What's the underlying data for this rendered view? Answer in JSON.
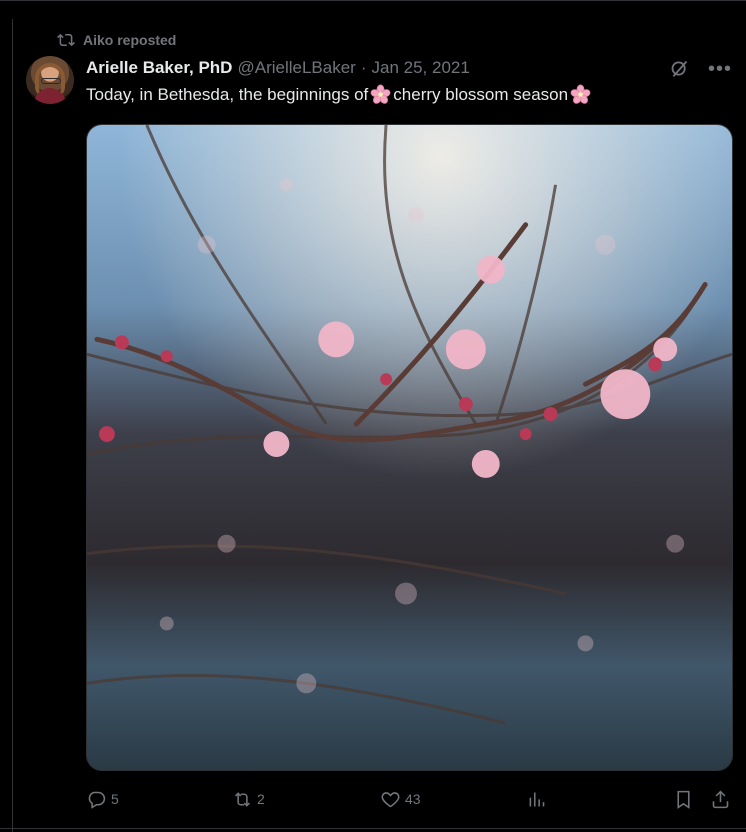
{
  "repost": {
    "label": "Aiko reposted",
    "icon": "repost-icon"
  },
  "author": {
    "name": "Arielle Baker, PhD",
    "handle": "@ArielleLBaker",
    "separator": "·",
    "date": "Jan 25, 2021"
  },
  "tweet": {
    "text": "Today, in Bethesda, the beginnings of ",
    "text_end": "cherry blossom season",
    "emoji": "cherry-blossom-icon"
  },
  "media": {
    "description_icon": "photo"
  },
  "header_icons": [
    "grok-icon",
    "more-icon"
  ],
  "actions": {
    "reply": {
      "count": "5",
      "icon": "reply-icon"
    },
    "repost": {
      "count": "2",
      "icon": "repost-icon"
    },
    "like": {
      "count": "43",
      "icon": "heart-icon"
    },
    "views": {
      "icon": "analytics-icon"
    },
    "bookmark": {
      "icon": "bookmark-icon"
    },
    "share": {
      "icon": "share-icon"
    }
  },
  "colors": {
    "background": "#000000",
    "text": "#e7e9ea",
    "muted": "#71767b",
    "border": "#2f3336",
    "blossom": "#f3a6c2"
  }
}
